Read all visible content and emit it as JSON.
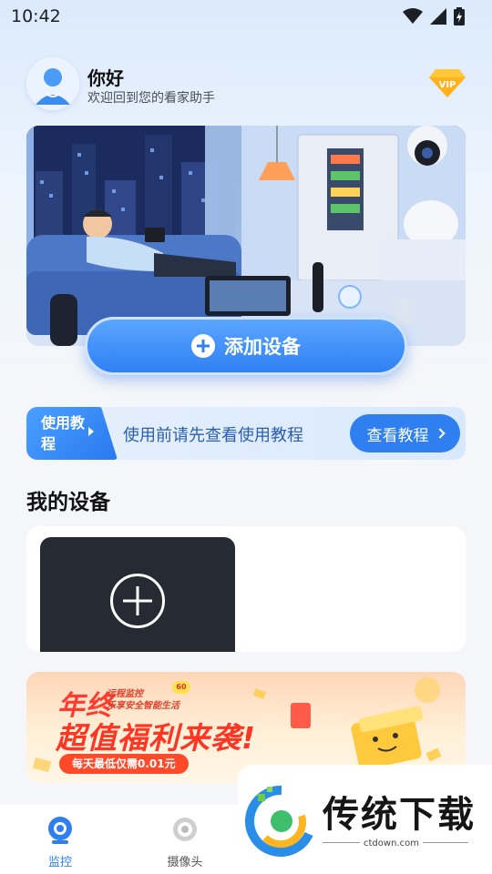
{
  "status_bar": {
    "time": "10:42",
    "icons": [
      "wifi-icon",
      "signal-icon",
      "battery-icon"
    ]
  },
  "header": {
    "greeting": "你好",
    "subtitle": "欢迎回到您的看家助手",
    "vip_label": "VIP"
  },
  "hero": {
    "add_device_label": "添加设备"
  },
  "tutorial": {
    "tag": "使用教程",
    "text": "使用前请先查看使用教程",
    "button_label": "查看教程"
  },
  "devices": {
    "section_title": "我的设备"
  },
  "promo": {
    "title_line1": "年终",
    "sub_line1": "远程监控",
    "sub_line2": "乐享安全智能生活",
    "badge": "60",
    "title_line2": "超值福利来袭!",
    "pill": "每天最低仅需0.01元"
  },
  "bottom_nav": {
    "items": [
      {
        "label": "监控",
        "icon": "camera-round-icon",
        "active": true
      },
      {
        "label": "摄像头",
        "icon": "lens-icon",
        "active": false
      }
    ]
  },
  "watermark": {
    "brand": "传统下载",
    "url": "ctdown.com"
  },
  "colors": {
    "accent": "#2f7ff0",
    "promo_red": "#ff3524",
    "tile_dark": "#262a33"
  }
}
